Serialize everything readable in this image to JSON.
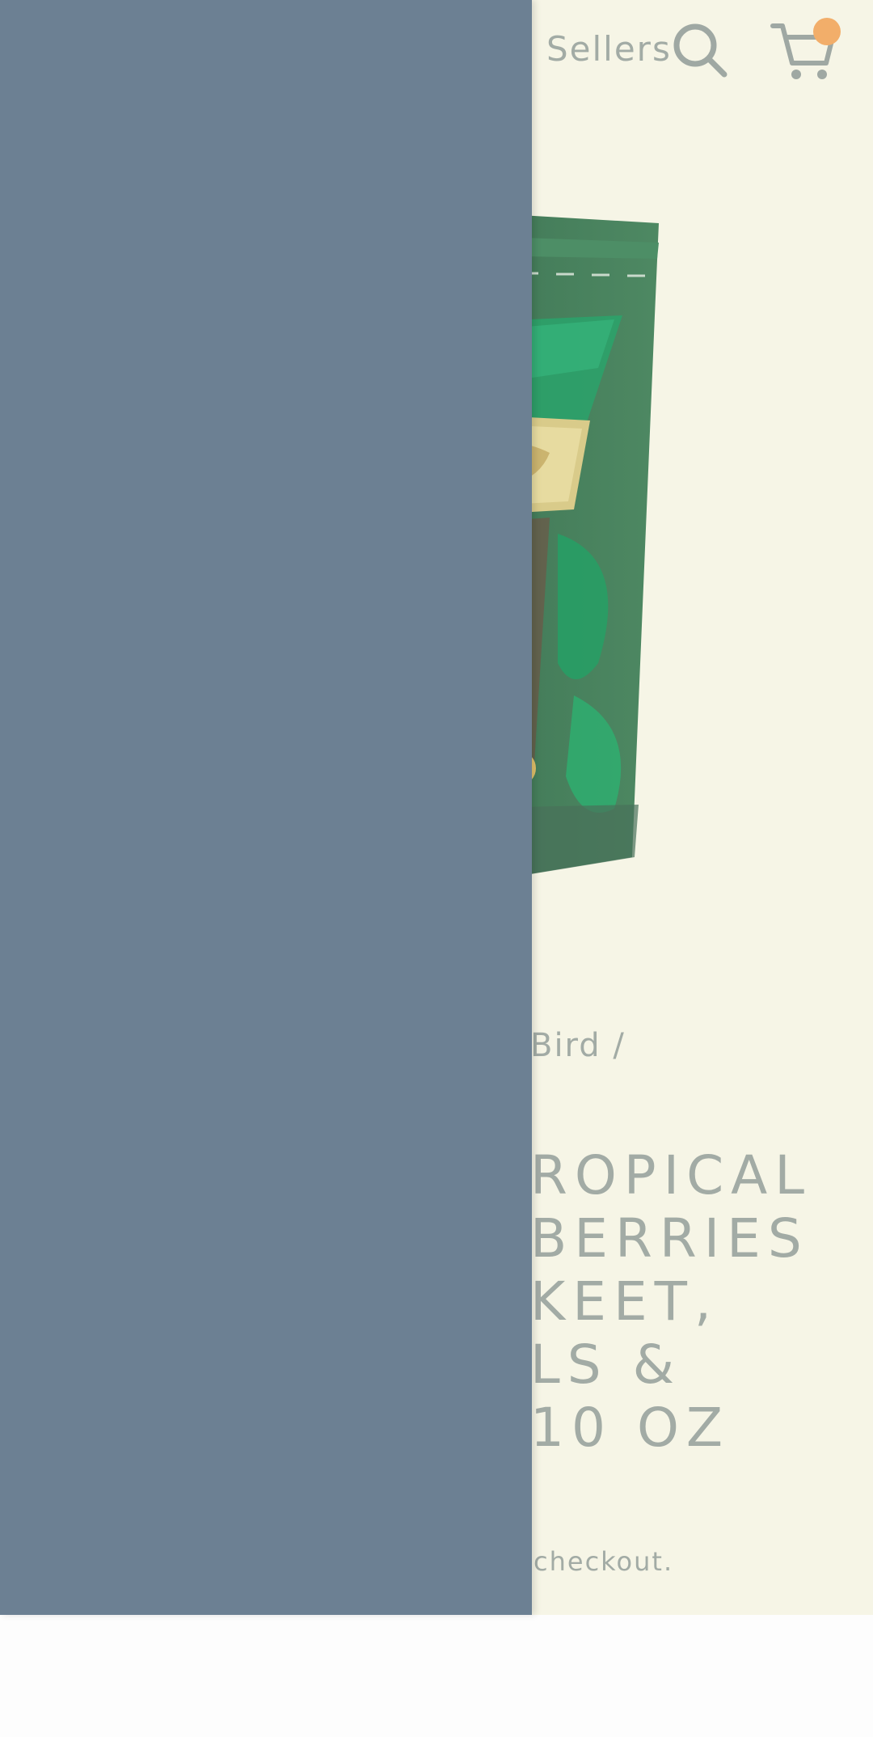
{
  "header": {
    "sellers_label": "Sellers",
    "search_icon": "search-icon",
    "cart_icon": "cart-icon",
    "cart_badge_color": "#f2ae6a"
  },
  "product": {
    "breadcrumb_visible": "Bird /",
    "title_lines": [
      "ROPICAL",
      "BERRIES",
      "KEET,",
      "LS &",
      "10 OZ"
    ],
    "checkout_note": "checkout."
  },
  "drawer": {
    "color": "#6c8093"
  }
}
